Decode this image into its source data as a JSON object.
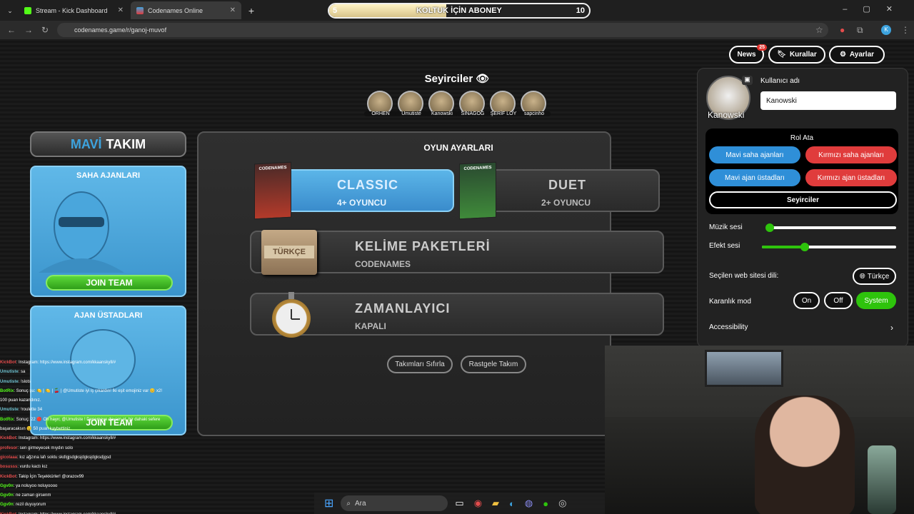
{
  "browser": {
    "tabs": [
      {
        "title": "Stream - Kick Dashboard"
      },
      {
        "title": "Codenames Online"
      }
    ],
    "url": "codenames.game/r/ganoj-muvof"
  },
  "overlay": {
    "min": "5",
    "text": "KOLTUK İÇİN ABONEY",
    "max": "10",
    "progress": 0.45
  },
  "topbar": {
    "news_label": "News",
    "news_badge": "25",
    "rules_label": "Kurallar",
    "settings_label": "Ayarlar"
  },
  "spectators": {
    "title": "Seyirciler",
    "names": [
      "ORHEN",
      "Umutiste",
      "Kanowski",
      "SİNAGOG",
      "ŞERİF LOY",
      "sapcinho"
    ]
  },
  "blue_team": {
    "title_colored": "MAVİ",
    "title_rest": "TAKIM",
    "operatives_title": "SAHA AJANLARI",
    "spymasters_title": "AJAN ÜSTADLARI",
    "join_label": "JOIN TEAM"
  },
  "game_settings": {
    "title": "OYUN AYARLARI",
    "classic_main": "CLASSIC",
    "classic_sub": "4+ OYUNCU",
    "duet_main": "DUET",
    "duet_sub": "2+ OYUNCU",
    "words_main": "KELİME PAKETLERİ",
    "words_sub": "CODENAMES",
    "words_box_label": "TÜRKÇE",
    "box_title": "CODENAMES",
    "timer_main": "ZAMANLAYICI",
    "timer_sub": "KAPALI",
    "reset_teams": "Takımları Sıfırla",
    "random_team": "Rastgele Takım"
  },
  "panel": {
    "username_label": "Kullanıcı adı",
    "username_value": "Kanowski",
    "avatar_name": "Kanowski",
    "role_title": "Rol Ata",
    "blue_operatives": "Mavi saha ajanları",
    "red_operatives": "Kırmızı saha ajanları",
    "blue_spymasters": "Mavi ajan üstadları",
    "red_spymasters": "Kırmızı ajan üstadları",
    "spectators": "Seyirciler",
    "music_label": "Müzik sesi",
    "music_level": 0.03,
    "effects_label": "Efekt sesi",
    "effects_level": 0.32,
    "language_label": "Seçilen web sitesi dili:",
    "language_value": "Türkçe",
    "dark_label": "Karanlık mod",
    "dark_on": "On",
    "dark_off": "Off",
    "dark_system": "System",
    "accessibility_label": "Accessibility"
  },
  "chat": [
    {
      "user": "KickBot",
      "msg": ": Instagram: https://www.instagram.com/kkaanskyll/#",
      "color": "#e34c4c"
    },
    {
      "user": "Umutiste",
      "msg": ": sa",
      "color": "#6fc2d0"
    },
    {
      "user": "Umutiste",
      "msg": ": !slots",
      "color": "#6fc2d0"
    },
    {
      "user": "BotRix",
      "msg": ": Sonuç şu: 🍋 | 🍋 | 🍒 | @Umutiste iyi iş çıkardın! İki eşit emojiniz var 😊 x2!",
      "color": "#53fc18"
    },
    {
      "user": "",
      "msg": "100 puan kazandınız.",
      "color": "#ffffff"
    },
    {
      "user": "Umutiste",
      "msg": ": !roulette 34",
      "color": "#6fc2d0"
    },
    {
      "user": "BotRix",
      "msg": ": Sonuç: 22 🔴 Oh hayır, @Umutiste ! Denemeye devam et, bir dahaki sefere",
      "color": "#53fc18"
    },
    {
      "user": "",
      "msg": "başaracaksın 😉 50 puan kaybettiniz.",
      "color": "#ffffff"
    },
    {
      "user": "KickBot",
      "msg": ": Instagram: https://www.instagram.com/kkaanskyll/#",
      "color": "#e34c4c"
    },
    {
      "user": "profesor",
      "msg": ": sen girmeyecek mıydın solo",
      "color": "#e34c4c"
    },
    {
      "user": "gicolaaa",
      "msg": ": kız ağzına lafı soktu skdlgjsdgksjdgksjdgksdjgsd",
      "color": "#e34c4c"
    },
    {
      "user": "bosusss",
      "msg": ": vurdu kactı kız",
      "color": "#e34c4c"
    },
    {
      "user": "KickBot",
      "msg": ": Takip İçin Teşekkürler! @orazov99",
      "color": "#e34c4c"
    },
    {
      "user": "Ggv0n",
      "msg": ": ya noluyoo noluyoooo",
      "color": "#53fc18"
    },
    {
      "user": "Ggv0n",
      "msg": ": ne zaman girsenm",
      "color": "#53fc18"
    },
    {
      "user": "Ggv0n",
      "msg": ": rezil duyuyorum",
      "color": "#53fc18"
    },
    {
      "user": "KickBot",
      "msg": ": Instagram: https://www.instagram.com/kkaanskyll/#",
      "color": "#e34c4c"
    }
  ],
  "taskbar": {
    "search_placeholder": "Ara"
  },
  "colors": {
    "blue_team": "#3da3de",
    "red_team": "#e03c3c",
    "green": "#2ec40c"
  }
}
